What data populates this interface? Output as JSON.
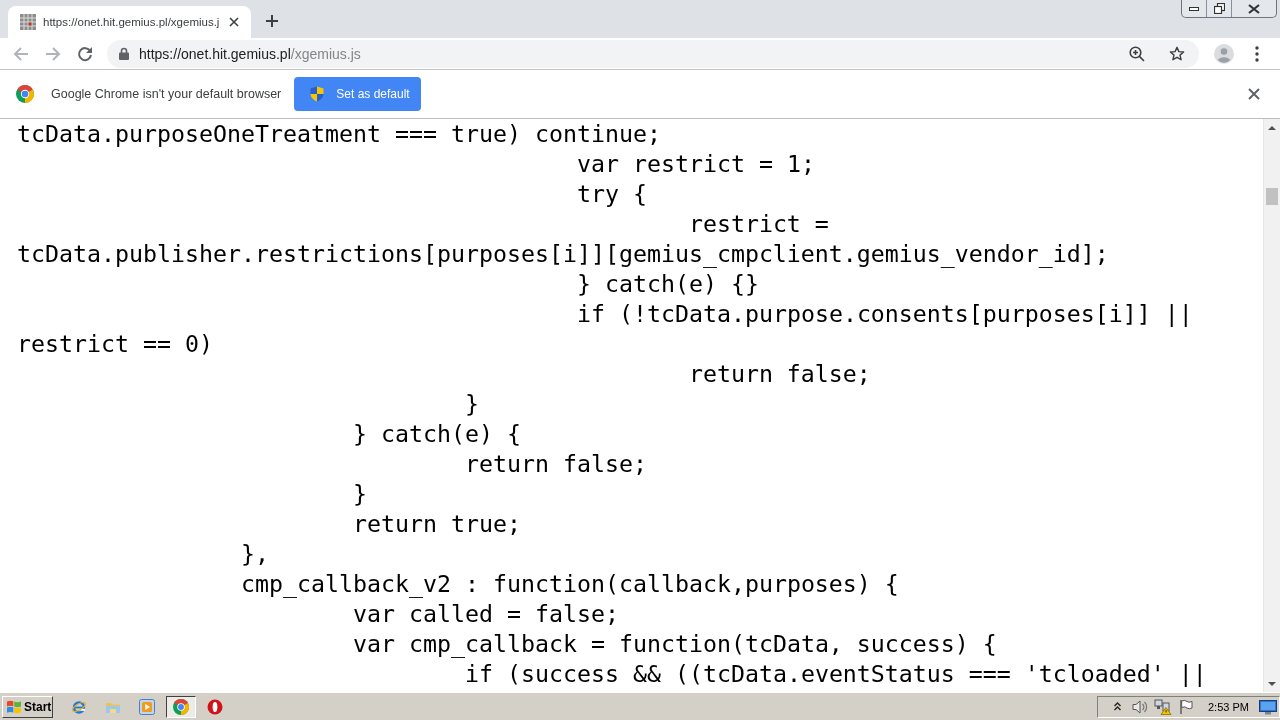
{
  "browser": {
    "tabs": [
      {
        "title": "https://onet.hit.gemius.pl/xgemius.j",
        "selected": true
      }
    ],
    "back_disabled": true,
    "forward_disabled": true,
    "url": "https://onet.hit.gemius.pl/xgemius.js"
  },
  "infobar": {
    "message": "Google Chrome isn't your default browser",
    "button": "Set as default"
  },
  "code_lines": [
    "tcData.purposeOneTreatment === true) continue;",
    "\t\t\t\t\tvar restrict = 1;",
    "\t\t\t\t\ttry {",
    "\t\t\t\t\t\trestrict =",
    "tcData.publisher.restrictions[purposes[i]][gemius_cmpclient.gemius_vendor_id];",
    "\t\t\t\t\t} catch(e) {}",
    "\t\t\t\t\tif (!tcData.purpose.consents[purposes[i]] ||",
    "restrict == 0)",
    "\t\t\t\t\t\treturn false;",
    "\t\t\t\t}",
    "\t\t\t} catch(e) {",
    "\t\t\t\treturn false;",
    "\t\t\t}",
    "\t\t\treturn true;",
    "\t\t},",
    "\t\tcmp_callback_v2 : function(callback,purposes) {",
    "\t\t\tvar called = false;",
    "\t\t\tvar cmp_callback = function(tcData, success) {",
    "\t\t\t\tif (success && ((tcData.eventStatus === 'tcloaded' ||"
  ],
  "taskbar": {
    "start": "Start",
    "apps": [
      {
        "kind": "ie",
        "selected": false
      },
      {
        "kind": "folder",
        "selected": false
      },
      {
        "kind": "media",
        "selected": false
      },
      {
        "kind": "chrome",
        "selected": true
      },
      {
        "kind": "opera",
        "selected": false
      }
    ],
    "clock": "2:53 PM"
  }
}
